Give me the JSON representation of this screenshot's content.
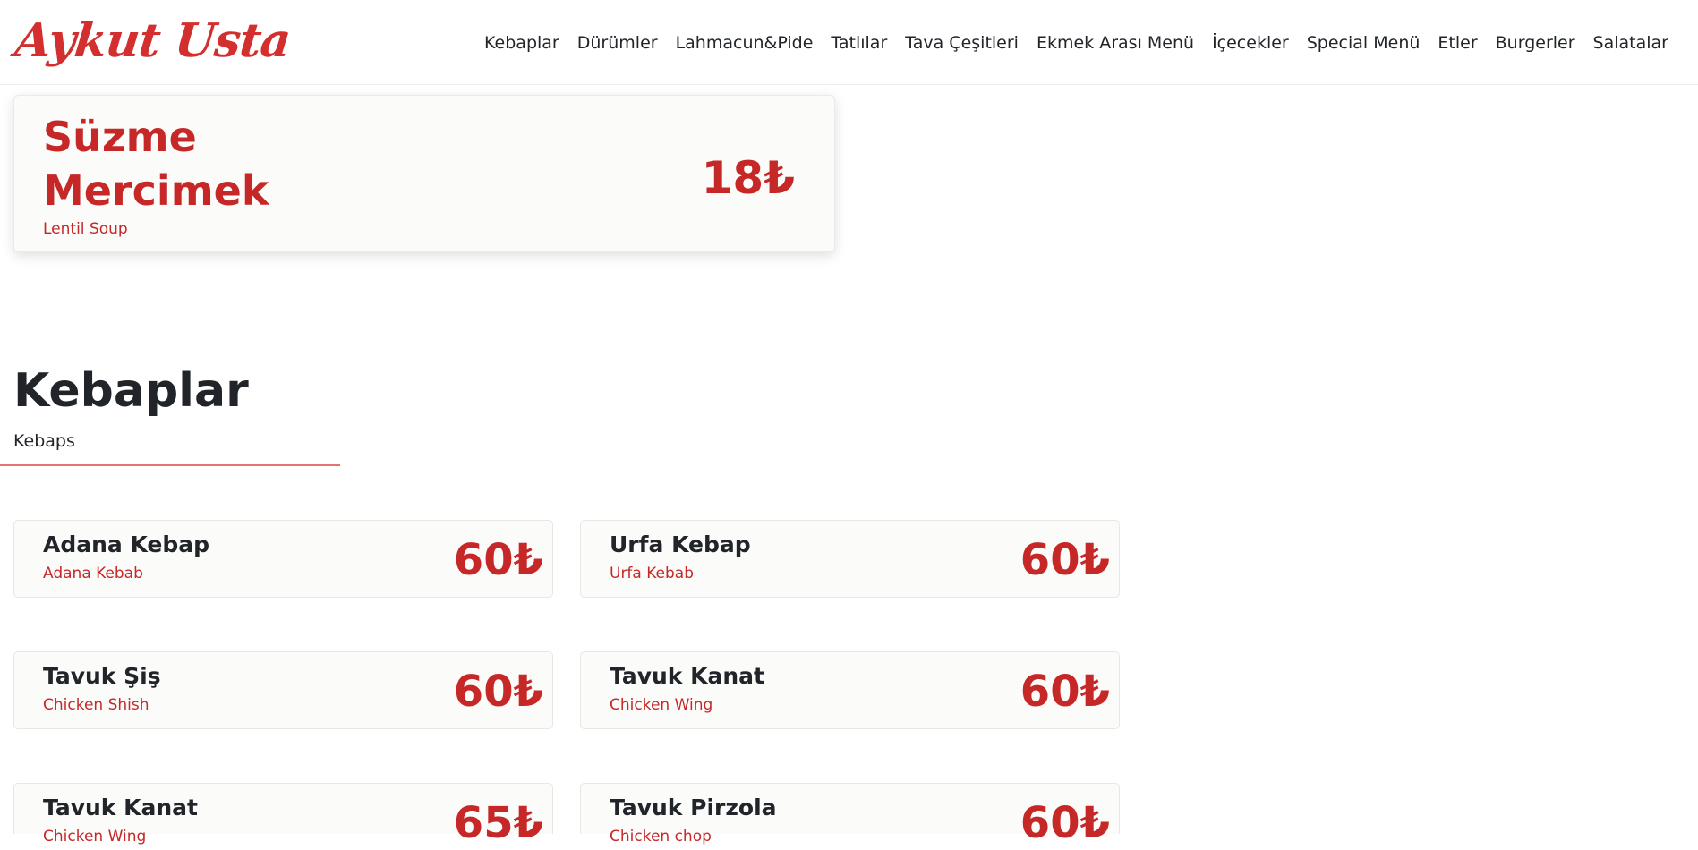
{
  "brand": {
    "name": "Aykut Usta",
    "color": "#d32f2f"
  },
  "nav": {
    "items": [
      {
        "label": "Kebaplar"
      },
      {
        "label": "Dürümler"
      },
      {
        "label": "Lahmacun&Pide"
      },
      {
        "label": "Tatlılar"
      },
      {
        "label": "Tava Çeşitleri"
      },
      {
        "label": "Ekmek Arası Menü"
      },
      {
        "label": "İçecekler"
      },
      {
        "label": "Special Menü"
      },
      {
        "label": "Etler"
      },
      {
        "label": "Burgerler"
      },
      {
        "label": "Salatalar"
      }
    ]
  },
  "featured": {
    "name": "Süzme Mercimek",
    "subtitle": "Lentil Soup",
    "price": "18₺"
  },
  "section": {
    "title": "Kebaplar",
    "subtitle": "Kebaps",
    "items": [
      {
        "name": "Adana Kebap",
        "subtitle": "Adana Kebab",
        "price": "60₺"
      },
      {
        "name": "Urfa Kebap",
        "subtitle": "Urfa Kebab",
        "price": "60₺"
      },
      {
        "name": "Tavuk Şiş",
        "subtitle": "Chicken Shish",
        "price": "60₺"
      },
      {
        "name": "Tavuk Kanat",
        "subtitle": "Chicken Wing",
        "price": "60₺"
      },
      {
        "name": "Tavuk Kanat",
        "subtitle": "Chicken Wing",
        "price": "65₺"
      },
      {
        "name": "Tavuk Pirzola",
        "subtitle": "Chicken chop",
        "price": "60₺"
      }
    ]
  },
  "colors": {
    "accent": "#c62828",
    "text": "#212529",
    "card": "#fbfbfa"
  }
}
